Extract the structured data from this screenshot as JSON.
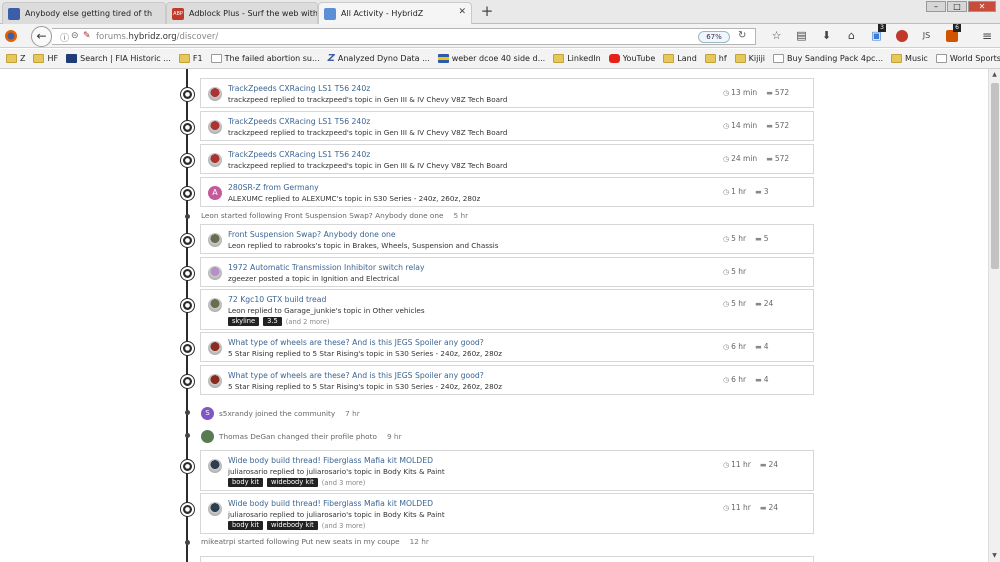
{
  "browser": {
    "tabs": [
      {
        "title": "Anybody else getting tired of th",
        "favicon_color": "#3b5ea8",
        "active": false
      },
      {
        "title": "Adblock Plus - Surf the web with",
        "favicon_color": "#c0392b",
        "active": false
      },
      {
        "title": "All Activity - HybridZ",
        "favicon_color": "#5b8fd6",
        "active": true
      }
    ],
    "new_tab": "+",
    "window_buttons": {
      "minimize": "–",
      "maximize": "□",
      "close": "✕"
    },
    "url_prefix": "forums.",
    "url_domain": "hybridz.org",
    "url_path": "/discover/",
    "zoom": "67%",
    "profile_initials": "JS",
    "badges": {
      "pocket": "3",
      "ext": "6"
    },
    "bookmarks": [
      {
        "label": "Z",
        "kind": "folder"
      },
      {
        "label": "HF",
        "kind": "folder"
      },
      {
        "label": "Search | FIA Historic ...",
        "kind": "fia"
      },
      {
        "label": "F1",
        "kind": "folder"
      },
      {
        "label": "The failed abortion su...",
        "kind": "page"
      },
      {
        "label": "Analyzed Dyno Data ...",
        "kind": "z"
      },
      {
        "label": "weber dcoe 40 side d...",
        "kind": "flag"
      },
      {
        "label": "LinkedIn",
        "kind": "folder"
      },
      {
        "label": "YouTube",
        "kind": "yt"
      },
      {
        "label": "Land",
        "kind": "folder"
      },
      {
        "label": "hf",
        "kind": "folder"
      },
      {
        "label": "Kijiji",
        "kind": "folder"
      },
      {
        "label": "Buy Sanding Pack 4pc...",
        "kind": "page"
      },
      {
        "label": "Music",
        "kind": "folder"
      },
      {
        "label": "World Sports Racing ...",
        "kind": "page"
      }
    ]
  },
  "activity": {
    "items": [
      {
        "title": "TrackZpeeds CXRacing LS1 T56 240z",
        "sub": "trackzpeed replied to trackzpeed's topic in Gen III & IV Chevy V8Z Tech Board",
        "time": "13 min",
        "replies": "572",
        "avatar_color": "#a33"
      },
      {
        "title": "TrackZpeeds CXRacing LS1 T56 240z",
        "sub": "trackzpeed replied to trackzpeed's topic in Gen III & IV Chevy V8Z Tech Board",
        "time": "14 min",
        "replies": "572",
        "avatar_color": "#a33"
      },
      {
        "title": "TrackZpeeds CXRacing LS1 T56 240z",
        "sub": "trackzpeed replied to trackzpeed's topic in Gen III & IV Chevy V8Z Tech Board",
        "time": "24 min",
        "replies": "572",
        "avatar_color": "#a33"
      },
      {
        "title": "280SR-Z from Germany",
        "sub": "ALEXUMC replied to ALEXUMC's topic in S30 Series - 240z, 260z, 280z",
        "time": "1 hr",
        "replies": "3",
        "avatar_letter": "A",
        "avatar_color": "#c45a9a"
      },
      {
        "title": "Front Suspension Swap? Anybody done one",
        "sub": "Leon replied to rabrooks's topic in Brakes, Wheels, Suspension and Chassis",
        "time": "5 hr",
        "replies": "5",
        "avatar_color": "#6b6b4f"
      },
      {
        "title": "1972 Automatic Transmission Inhibitor switch relay",
        "sub": "zgeezer posted a topic in Ignition and Electrical",
        "time": "5 hr",
        "replies": "",
        "avatar_color": "#b58fc7"
      },
      {
        "title": "72 Kgc10 GTX build tread",
        "sub": "Leon replied to Garage_junkie's topic in Other vehicles",
        "time": "5 hr",
        "replies": "24",
        "avatar_color": "#6b6b4f",
        "tags": [
          "skyline",
          "3.5"
        ],
        "more": "(and 2 more)"
      },
      {
        "title": "What type of wheels are these? And is this JEGS Spoiler any good?",
        "sub": "5 Star Rising replied to 5 Star Rising's topic in S30 Series - 240z, 260z, 280z",
        "time": "6 hr",
        "replies": "4",
        "avatar_color": "#8b2a1f"
      },
      {
        "title": "What type of wheels are these? And is this JEGS Spoiler any good?",
        "sub": "5 Star Rising replied to 5 Star Rising's topic in S30 Series - 240z, 260z, 280z",
        "time": "6 hr",
        "replies": "4",
        "avatar_color": "#8b2a1f"
      },
      {
        "title": "Wide body build thread! Fiberglass Mafia kit MOLDED",
        "sub": "juliarosario replied to juliarosario's topic in Body Kits & Paint",
        "time": "11 hr",
        "replies": "24",
        "avatar_color": "#2c3e50",
        "tags": [
          "body kit",
          "widebody kit"
        ],
        "more": "(and 3 more)"
      },
      {
        "title": "Wide body build thread! Fiberglass Mafia kit MOLDED",
        "sub": "juliarosario replied to juliarosario's topic in Body Kits & Paint",
        "time": "11 hr",
        "replies": "24",
        "avatar_color": "#2c3e50",
        "tags": [
          "body kit",
          "widebody kit"
        ],
        "more": "(and 3 more)"
      }
    ],
    "events": [
      {
        "text": "Leon started following Front Suspension Swap? Anybody done one",
        "time": "5 hr"
      },
      {
        "text": "s5xrandy joined the community",
        "time": "7 hr",
        "avatar_letter": "S",
        "avatar_color": "#7e57c2"
      },
      {
        "text": "Thomas DeGan changed their profile photo",
        "time": "9 hr",
        "avatar_color": "#5a7a4f"
      },
      {
        "text": "mikeatrpi started following Put new seats in my coupe",
        "time": "12 hr"
      }
    ],
    "partial_item_title": "Put new seats in my coupe"
  }
}
